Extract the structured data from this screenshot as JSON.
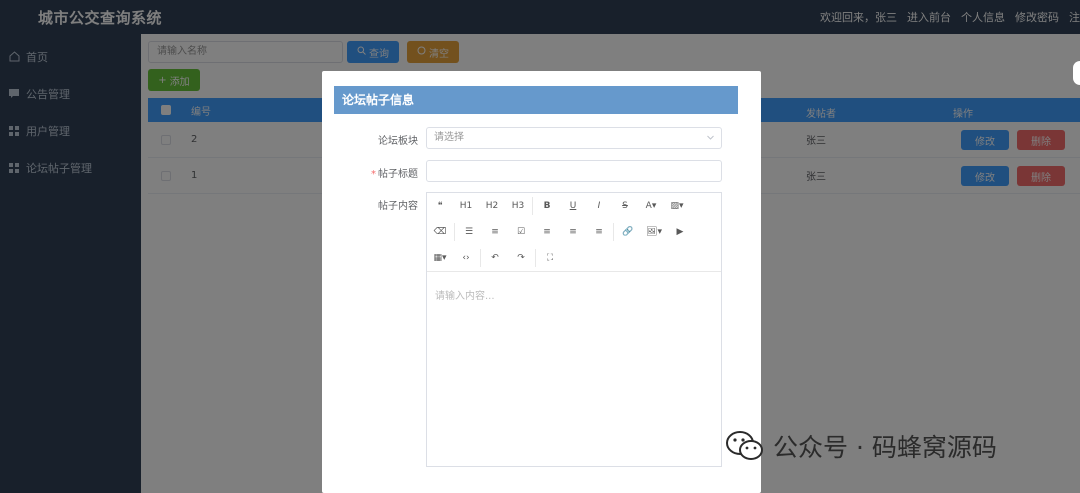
{
  "header": {
    "title": "城市公交查询系统",
    "nav": [
      "欢迎回来，张三",
      "进入前台",
      "个人信息",
      "修改密码",
      "注"
    ]
  },
  "sidebar": {
    "items": [
      {
        "label": "首页",
        "icon": "home-icon"
      },
      {
        "label": "公告管理",
        "icon": "notice-icon"
      },
      {
        "label": "用户管理",
        "icon": "grid-icon"
      },
      {
        "label": "论坛帖子管理",
        "icon": "grid-icon"
      }
    ]
  },
  "main": {
    "search_placeholder": "请输入名称",
    "query_label": "查询",
    "clear_label": "清空",
    "add_label": "添加",
    "table": {
      "headers": [
        "编号",
        "发帖者",
        "操作"
      ],
      "rows": [
        {
          "id": "2",
          "author": "张三"
        },
        {
          "id": "1",
          "author": "张三"
        }
      ],
      "edit_label": "修改",
      "delete_label": "删除"
    }
  },
  "dialog": {
    "title": "论坛帖子信息",
    "section_label": "论坛板块",
    "section_placeholder": "请选择",
    "post_title_label": "帖子标题",
    "content_label": "帖子内容",
    "editor_placeholder": "请输入内容...",
    "toolbar_row1": [
      "❝",
      "H1",
      "H2",
      "H3",
      "B",
      "U",
      "I",
      "S",
      "A▾",
      "▨▾"
    ],
    "toolbar_row2": [
      "⌫",
      "☰",
      "≡",
      "☑",
      "≡",
      "≡",
      "≡",
      "🔗",
      "🖼▾",
      "▶"
    ],
    "toolbar_row3": [
      "▦▾",
      "‹›",
      "↶",
      "↷",
      "⛶"
    ]
  },
  "watermark": {
    "text": "公众号 · 码蜂窝源码"
  },
  "colors": {
    "sidebar": "#304156",
    "primary": "#409eff",
    "warning": "#e6a23c",
    "success": "#67c23a",
    "danger": "#f56c6c",
    "dialog_title": "#6699cc"
  }
}
